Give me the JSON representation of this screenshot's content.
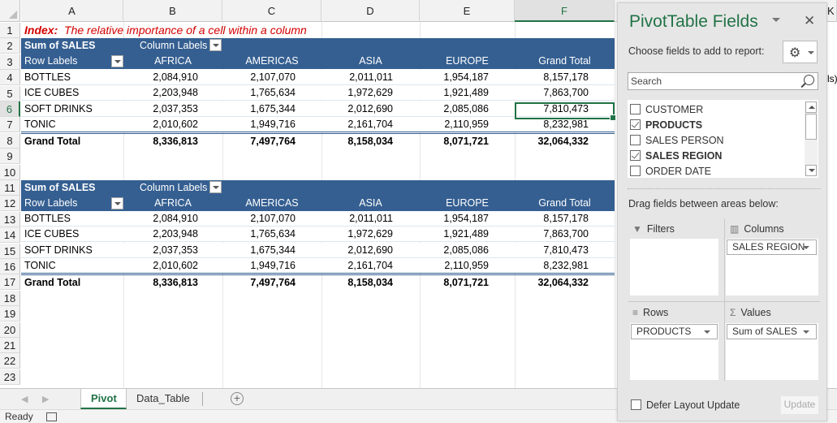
{
  "columns": [
    "A",
    "B",
    "C",
    "D",
    "E",
    "F",
    "K"
  ],
  "selected_column": "F",
  "selected_row": "6",
  "rows": [
    "1",
    "2",
    "3",
    "4",
    "5",
    "6",
    "7",
    "8",
    "9",
    "10",
    "11",
    "12",
    "13",
    "14",
    "15",
    "16",
    "17",
    "18",
    "19",
    "20",
    "21",
    "22",
    "23"
  ],
  "title": {
    "bold_part": "Index:",
    "rest": "The relative importance of a cell within a column"
  },
  "pivot1": {
    "value_label": "Sum of SALES",
    "column_labels": "Column Labels",
    "row_labels": "Row Labels",
    "headers": [
      "AFRICA",
      "AMERICAS",
      "ASIA",
      "EUROPE",
      "Grand Total"
    ],
    "rows": [
      {
        "label": "BOTTLES",
        "values": [
          "2,084,910",
          "2,107,070",
          "2,011,011",
          "1,954,187",
          "8,157,178"
        ]
      },
      {
        "label": "ICE CUBES",
        "values": [
          "2,203,948",
          "1,765,634",
          "1,972,629",
          "1,921,489",
          "7,863,700"
        ]
      },
      {
        "label": "SOFT DRINKS",
        "values": [
          "2,037,353",
          "1,675,344",
          "2,012,690",
          "2,085,086",
          "7,810,473"
        ]
      },
      {
        "label": "TONIC",
        "values": [
          "2,010,602",
          "1,949,716",
          "2,161,704",
          "2,110,959",
          "8,232,981"
        ]
      }
    ],
    "total": {
      "label": "Grand Total",
      "values": [
        "8,336,813",
        "7,497,764",
        "8,158,034",
        "8,071,721",
        "32,064,332"
      ]
    }
  },
  "pivot2": {
    "value_label": "Sum of SALES",
    "column_labels": "Column Labels",
    "row_labels": "Row Labels",
    "headers": [
      "AFRICA",
      "AMERICAS",
      "ASIA",
      "EUROPE",
      "Grand Total"
    ],
    "rows": [
      {
        "label": "BOTTLES",
        "values": [
          "2,084,910",
          "2,107,070",
          "2,011,011",
          "1,954,187",
          "8,157,178"
        ]
      },
      {
        "label": "ICE CUBES",
        "values": [
          "2,203,948",
          "1,765,634",
          "1,972,629",
          "1,921,489",
          "7,863,700"
        ]
      },
      {
        "label": "SOFT DRINKS",
        "values": [
          "2,037,353",
          "1,675,344",
          "2,012,690",
          "2,085,086",
          "7,810,473"
        ]
      },
      {
        "label": "TONIC",
        "values": [
          "2,010,602",
          "1,949,716",
          "2,161,704",
          "2,110,959",
          "8,232,981"
        ]
      }
    ],
    "total": {
      "label": "Grand Total",
      "values": [
        "8,336,813",
        "7,497,764",
        "8,158,034",
        "8,071,721",
        "32,064,332"
      ]
    }
  },
  "behind_panel_text": "ls)",
  "sheet_tabs": [
    {
      "label": "Pivot",
      "active": true
    },
    {
      "label": "Data_Table",
      "active": false
    }
  ],
  "status": {
    "text": "Ready"
  },
  "pivot_panel": {
    "title": "PivotTable Fields",
    "close_glyph": "✕",
    "choose_label": "Choose fields to add to report:",
    "gear_glyph": "⚙",
    "search_placeholder": "Search",
    "fields": [
      {
        "label": "CUSTOMER",
        "checked": false
      },
      {
        "label": "PRODUCTS",
        "checked": true
      },
      {
        "label": "SALES PERSON",
        "checked": false
      },
      {
        "label": "SALES REGION",
        "checked": true
      },
      {
        "label": "ORDER DATE",
        "checked": false
      }
    ],
    "drag_label": "Drag fields between areas below:",
    "areas": {
      "filters": {
        "label": "Filters",
        "items": []
      },
      "columns": {
        "label": "Columns",
        "items": [
          "SALES REGION"
        ]
      },
      "rows": {
        "label": "Rows",
        "items": [
          "PRODUCTS"
        ]
      },
      "values": {
        "label": "Values",
        "items": [
          "Sum of SALES"
        ]
      }
    },
    "defer_label": "Defer Layout Update",
    "update_label": "Update"
  },
  "colors": {
    "pivot_header": "#355f91",
    "excel_green": "#217346",
    "title_red": "#d40000"
  }
}
